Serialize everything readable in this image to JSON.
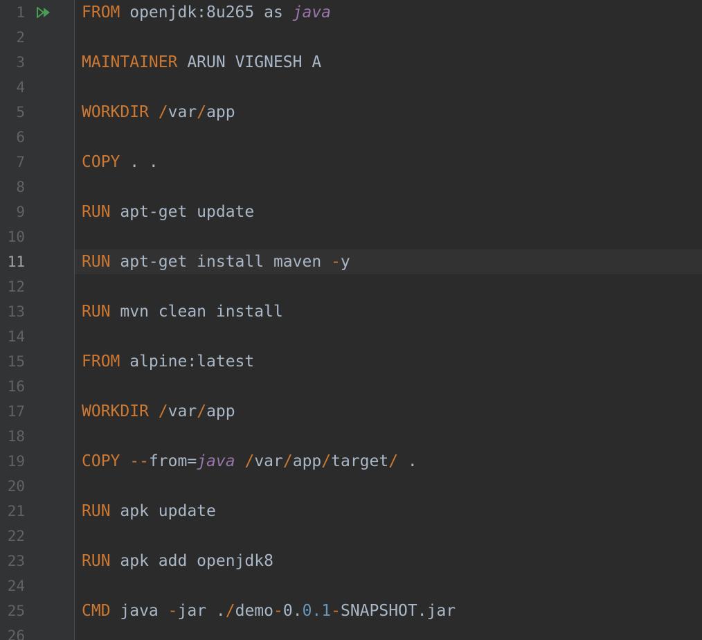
{
  "editor": {
    "language": "Dockerfile",
    "current_line": 11,
    "icons": {
      "run_gutter": "run-all-double-triangle-icon"
    },
    "colors": {
      "background": "#2b2b2b",
      "gutter": "#313335",
      "keyword": "#cc7832",
      "text": "#a9b7c6",
      "italic_ref": "#9876aa",
      "number": "#6897bb",
      "run_icon": "#499c54"
    },
    "lines": [
      {
        "no": "1",
        "tokens": [
          {
            "t": "FROM",
            "c": "kw"
          },
          {
            "t": " openjdk:8u265 as ",
            "c": "tx"
          },
          {
            "t": "java",
            "c": "it"
          }
        ]
      },
      {
        "no": "2",
        "tokens": []
      },
      {
        "no": "3",
        "tokens": [
          {
            "t": "MAINTAINER",
            "c": "kw"
          },
          {
            "t": " ARUN VIGNESH A",
            "c": "tx"
          }
        ]
      },
      {
        "no": "4",
        "tokens": []
      },
      {
        "no": "5",
        "tokens": [
          {
            "t": "WORKDIR",
            "c": "kw"
          },
          {
            "t": " ",
            "c": "tx"
          },
          {
            "t": "/",
            "c": "kw"
          },
          {
            "t": "var",
            "c": "tx"
          },
          {
            "t": "/",
            "c": "kw"
          },
          {
            "t": "app",
            "c": "tx"
          }
        ]
      },
      {
        "no": "6",
        "tokens": []
      },
      {
        "no": "7",
        "tokens": [
          {
            "t": "COPY",
            "c": "kw"
          },
          {
            "t": " . .",
            "c": "tx"
          }
        ]
      },
      {
        "no": "8",
        "tokens": []
      },
      {
        "no": "9",
        "tokens": [
          {
            "t": "RUN",
            "c": "kw"
          },
          {
            "t": " apt-get update",
            "c": "tx"
          }
        ]
      },
      {
        "no": "10",
        "tokens": []
      },
      {
        "no": "11",
        "tokens": [
          {
            "t": "RUN",
            "c": "kw"
          },
          {
            "t": " apt-get install maven ",
            "c": "tx"
          },
          {
            "t": "-",
            "c": "kw"
          },
          {
            "t": "y",
            "c": "tx"
          }
        ]
      },
      {
        "no": "12",
        "tokens": []
      },
      {
        "no": "13",
        "tokens": [
          {
            "t": "RUN",
            "c": "kw"
          },
          {
            "t": " mvn clean install",
            "c": "tx"
          }
        ]
      },
      {
        "no": "14",
        "tokens": []
      },
      {
        "no": "15",
        "tokens": [
          {
            "t": "FROM",
            "c": "kw"
          },
          {
            "t": " alpine:latest",
            "c": "tx"
          }
        ]
      },
      {
        "no": "16",
        "tokens": []
      },
      {
        "no": "17",
        "tokens": [
          {
            "t": "WORKDIR",
            "c": "kw"
          },
          {
            "t": " ",
            "c": "tx"
          },
          {
            "t": "/",
            "c": "kw"
          },
          {
            "t": "var",
            "c": "tx"
          },
          {
            "t": "/",
            "c": "kw"
          },
          {
            "t": "app",
            "c": "tx"
          }
        ]
      },
      {
        "no": "18",
        "tokens": []
      },
      {
        "no": "19",
        "tokens": [
          {
            "t": "COPY",
            "c": "kw"
          },
          {
            "t": " ",
            "c": "tx"
          },
          {
            "t": "--",
            "c": "kw"
          },
          {
            "t": "from=",
            "c": "tx"
          },
          {
            "t": "java",
            "c": "it"
          },
          {
            "t": " ",
            "c": "tx"
          },
          {
            "t": "/",
            "c": "kw"
          },
          {
            "t": "var",
            "c": "tx"
          },
          {
            "t": "/",
            "c": "kw"
          },
          {
            "t": "app",
            "c": "tx"
          },
          {
            "t": "/",
            "c": "kw"
          },
          {
            "t": "target",
            "c": "tx"
          },
          {
            "t": "/",
            "c": "kw"
          },
          {
            "t": " .",
            "c": "tx"
          }
        ]
      },
      {
        "no": "20",
        "tokens": []
      },
      {
        "no": "21",
        "tokens": [
          {
            "t": "RUN",
            "c": "kw"
          },
          {
            "t": " apk update",
            "c": "tx"
          }
        ]
      },
      {
        "no": "22",
        "tokens": []
      },
      {
        "no": "23",
        "tokens": [
          {
            "t": "RUN",
            "c": "kw"
          },
          {
            "t": " apk add openjdk8",
            "c": "tx"
          }
        ]
      },
      {
        "no": "24",
        "tokens": []
      },
      {
        "no": "25",
        "tokens": [
          {
            "t": "CMD",
            "c": "kw"
          },
          {
            "t": " java ",
            "c": "tx"
          },
          {
            "t": "-",
            "c": "kw"
          },
          {
            "t": "jar .",
            "c": "tx"
          },
          {
            "t": "/",
            "c": "kw"
          },
          {
            "t": "demo",
            "c": "tx"
          },
          {
            "t": "-",
            "c": "kw"
          },
          {
            "t": "0.",
            "c": "tx"
          },
          {
            "t": "0.1",
            "c": "num"
          },
          {
            "t": "-",
            "c": "kw"
          },
          {
            "t": "SNAPSHOT.jar",
            "c": "tx"
          }
        ]
      },
      {
        "no": "26",
        "tokens": []
      }
    ]
  }
}
